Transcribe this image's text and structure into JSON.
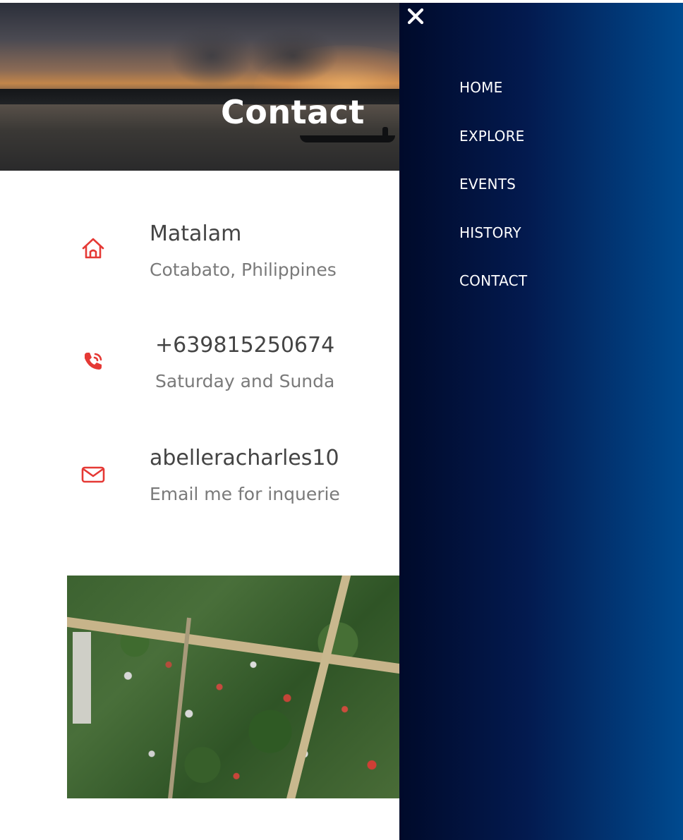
{
  "hero": {
    "title": "Contact"
  },
  "contact": {
    "items": [
      {
        "icon": "home-icon",
        "title": "Matalam",
        "subtitle": "Cotabato, Philippines"
      },
      {
        "icon": "phone-icon",
        "title": "+639815250674",
        "subtitle": "Saturday and Sunda"
      },
      {
        "icon": "envelope-icon",
        "title": "abelleracharles10",
        "subtitle": "Email me for inquerie"
      }
    ]
  },
  "sidenav": {
    "close_icon": "close-icon",
    "items": [
      {
        "label": "HOME"
      },
      {
        "label": "EXPLORE"
      },
      {
        "label": "EVENTS"
      },
      {
        "label": "HISTORY"
      },
      {
        "label": "CONTACT"
      }
    ]
  },
  "colors": {
    "accent_red": "#e53935",
    "nav_gradient_start": "#000a2a",
    "nav_gradient_end": "#004a8f",
    "title_text": "#444444",
    "subtitle_text": "#7a7a7a"
  }
}
